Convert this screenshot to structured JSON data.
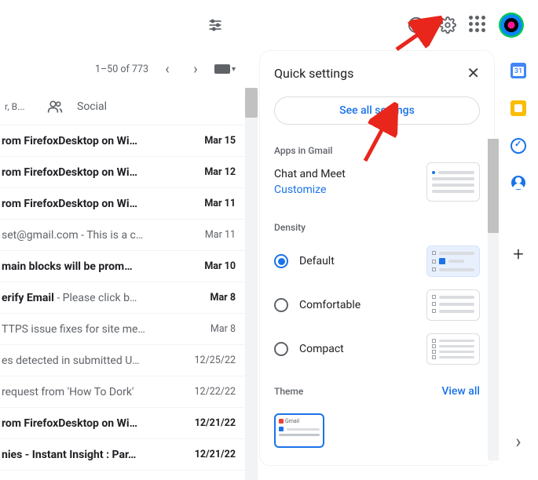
{
  "pager": {
    "range": "1–50 of 773"
  },
  "tabs": {
    "sub_label": "r, B...",
    "social_label": "Social"
  },
  "mail": [
    {
      "subject": "rom FirefoxDesktop on Wi…",
      "date": "Mar 15",
      "read": false
    },
    {
      "subject": "rom FirefoxDesktop on Wi…",
      "date": "Mar 12",
      "read": false
    },
    {
      "subject": "rom FirefoxDesktop on Wi…",
      "date": "Mar 11",
      "read": false
    },
    {
      "subject": "set@gmail.com",
      "snippet": " - This is a c…",
      "date": "Mar 11",
      "read": true
    },
    {
      "subject": "main blocks will be prom…",
      "date": "Mar 10",
      "read": false
    },
    {
      "subject": "erify Email",
      "snippet": " - Please click b…",
      "date": "Mar 8",
      "read": false
    },
    {
      "subject": "TTPS issue fixes for site me…",
      "date": "Mar 8",
      "read": true
    },
    {
      "subject": "es detected in submitted U…",
      "date": "12/25/22",
      "read": true
    },
    {
      "subject": "request from 'How To Dork'",
      "date": "12/22/22",
      "read": true
    },
    {
      "subject": "rom FirefoxDesktop on Wi…",
      "date": "12/21/22",
      "read": false
    },
    {
      "subject": "nies - Instant Insight : Par…",
      "date": "12/21/22",
      "read": false
    }
  ],
  "quick_settings": {
    "title": "Quick settings",
    "see_all": "See all settings",
    "apps_section": "Apps in Gmail",
    "apps_line1": "Chat and Meet",
    "apps_customize": "Customize",
    "density_section": "Density",
    "density": {
      "default": "Default",
      "comfortable": "Comfortable",
      "compact": "Compact"
    },
    "theme_section": "Theme",
    "theme_view_all": "View all",
    "theme_thumb_label": "Gmail"
  },
  "rail": {
    "calendar_day": "31"
  }
}
